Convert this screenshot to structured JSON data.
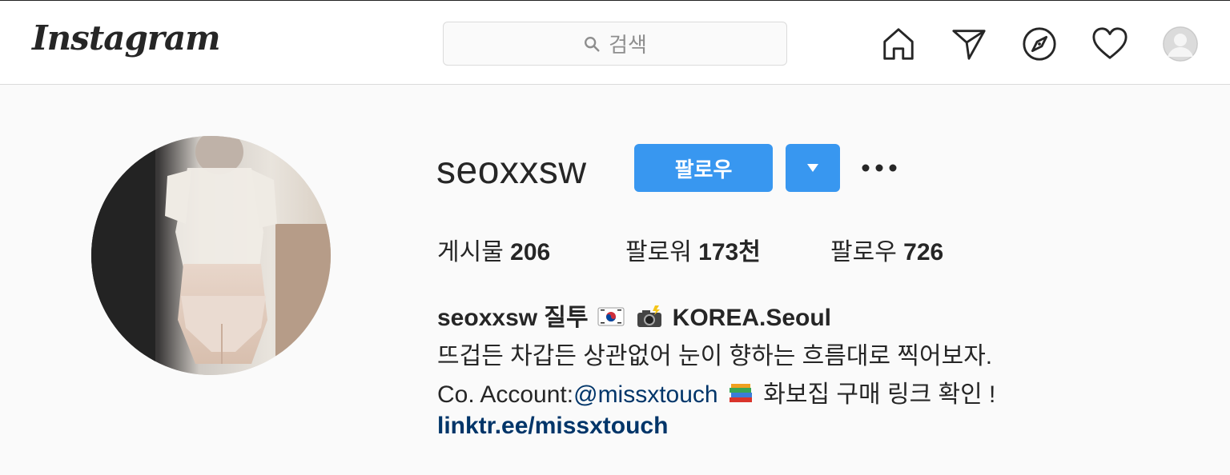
{
  "header": {
    "logo_text": "Instagram",
    "search_placeholder": "검색",
    "nav_icons": [
      "home-icon",
      "direct-icon",
      "explore-icon",
      "activity-heart-icon",
      "profile-avatar"
    ]
  },
  "profile": {
    "username": "seoxxsw",
    "follow_label": "팔로우",
    "stats": {
      "posts_label": "게시물",
      "posts_value": "206",
      "followers_label": "팔로워",
      "followers_value": "173천",
      "following_label": "팔로우",
      "following_value": "726"
    },
    "bio": {
      "name_prefix": "seoxxsw 질투",
      "name_suffix": "KOREA.Seoul",
      "description": "뜨겁든 차갑든 상관없어 눈이 향하는 흐름대로 찍어보자.",
      "account_prefix": "Co. Account:",
      "account_mention": "@missxtouch",
      "account_suffix": "화보집 구매 링크 확인 !",
      "link": "linktr.ee/missxtouch"
    }
  },
  "colors": {
    "accent": "#3897f0",
    "link": "#003569",
    "text": "#262626",
    "muted": "#8e8e8e",
    "background": "#fafafa"
  }
}
